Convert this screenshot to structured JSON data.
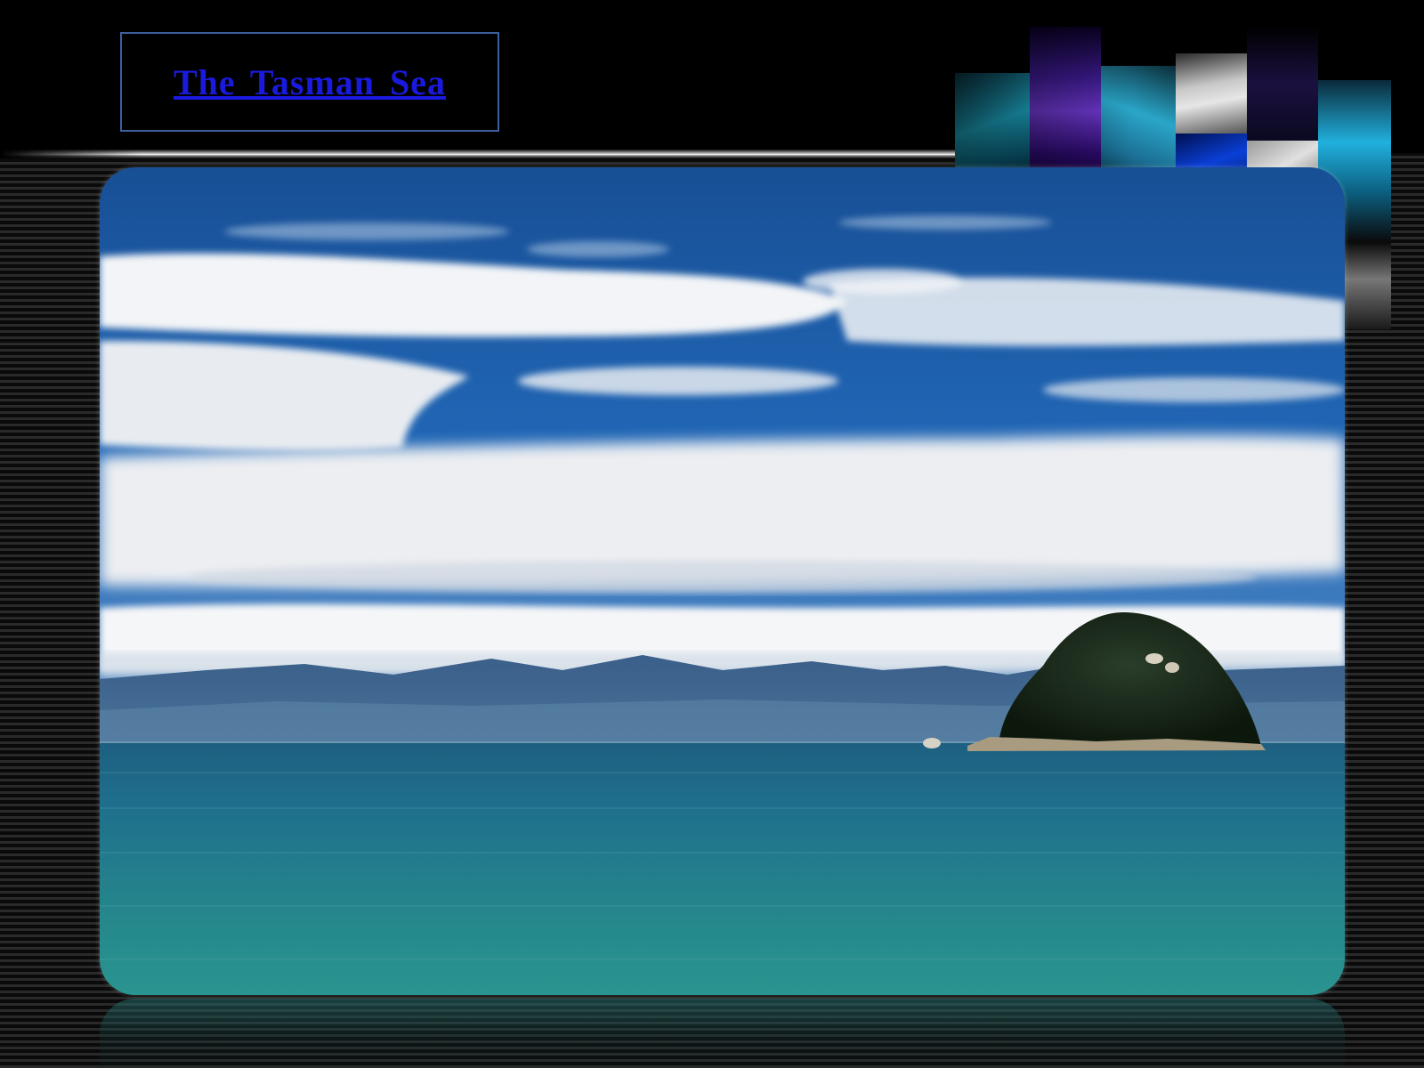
{
  "slide": {
    "title": "The Tasman Sea",
    "photo_subject": "sea-with-island-photo",
    "collage_subject": "map-collage-decoration"
  },
  "colors": {
    "background": "#000000",
    "title_link": "#1a1adf",
    "title_border": "#3d5f9e",
    "sky": "#1f5fae",
    "sea": "#2a8a8a"
  }
}
